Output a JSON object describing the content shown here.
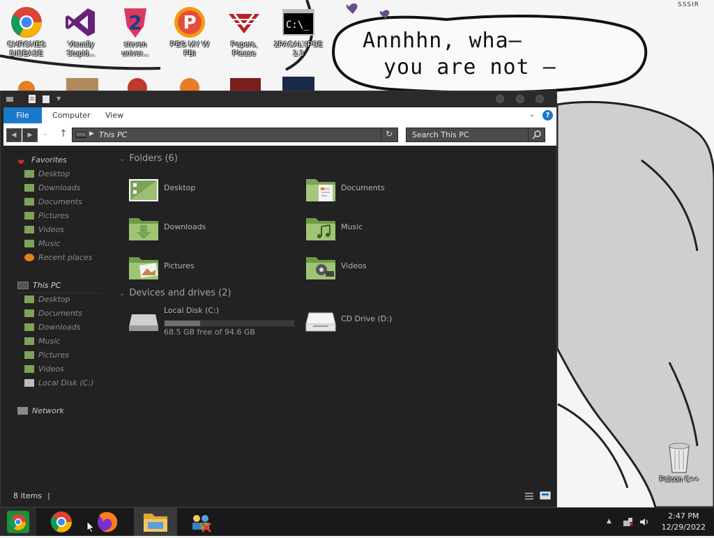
{
  "desktop": {
    "icons": [
      {
        "label": "CHRONES DISEASE",
        "icon": "chrome-icon"
      },
      {
        "label": "Visually Stupid...",
        "icon": "visual-studio-icon"
      },
      {
        "label": "steven univer...",
        "icon": "steven-universe-icon"
      },
      {
        "label": "PEG MY W FBI",
        "icon": "pegg-icon"
      },
      {
        "label": "Papers, Please",
        "icon": "papers-please-icon"
      },
      {
        "label": "2PACALYPSE 2.3",
        "icon": "cmd-icon"
      }
    ],
    "recycle_bin_label": "Falcon C++",
    "speech_line1": "Annhhn, wha—",
    "speech_line2": "you are not —",
    "corner_text": "SSSIR"
  },
  "explorer": {
    "ribbon": {
      "file": "File",
      "computer": "Computer",
      "view": "View"
    },
    "address": "This PC",
    "search_placeholder": "Search This PC",
    "nav": {
      "favorites_label": "Favorites",
      "favorites": [
        "Desktop",
        "Downloads",
        "Documents",
        "Pictures",
        "Videos",
        "Music",
        "Recent places"
      ],
      "this_pc_label": "This PC",
      "this_pc": [
        "Desktop",
        "Documents",
        "Downloads",
        "Music",
        "Pictures",
        "Videos",
        "Local Disk (C:)"
      ],
      "network_label": "Network"
    },
    "folders_header": "Folders (6)",
    "folders": [
      "Desktop",
      "Documents",
      "Downloads",
      "Music",
      "Pictures",
      "Videos"
    ],
    "drives_header": "Devices and drives (2)",
    "drives": [
      {
        "name": "Local Disk (C:)",
        "free": "68.5 GB free of 94.6 GB",
        "used_fraction": 0.276
      },
      {
        "name": "CD Drive (D:)"
      }
    ],
    "status": "8 items"
  },
  "taskbar": {
    "time": "2:47 PM",
    "date": "12/29/2022"
  },
  "colors": {
    "accent": "#1979ca",
    "folder_green": "#7da35a",
    "window_bg": "#222222"
  }
}
